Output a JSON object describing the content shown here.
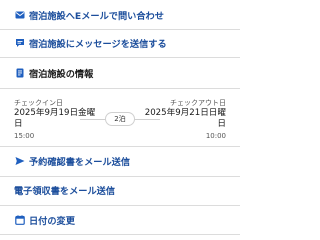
{
  "menu": {
    "email_property": "宿泊施設へEメールで問い合わせ",
    "message_property": "宿泊施設にメッセージを送信する",
    "property_info": "宿泊施設の情報",
    "send_confirmation": "予約確認書をメール送信",
    "send_receipt": "電子領収書をメール送信",
    "change_dates": "日付の変更"
  },
  "stay": {
    "checkin_label": "チェックイン日",
    "checkin_date_line1": "2025年9月19日金曜",
    "checkin_date_line2": "日",
    "checkin_time": "15:00",
    "checkout_label": "チェックアウト日",
    "checkout_date_line1": "2025年9月21日日曜",
    "checkout_date_line2": "日",
    "checkout_time": "10:00",
    "nights": "2泊"
  },
  "colors": {
    "link_blue": "#1c4e9c",
    "icon_blue": "#1f5fbf",
    "divider": "#dcdcdc"
  },
  "icons": {
    "email": "email-icon",
    "chat": "chat-icon",
    "info": "document-icon",
    "send": "send-icon",
    "calendar": "calendar-icon"
  }
}
